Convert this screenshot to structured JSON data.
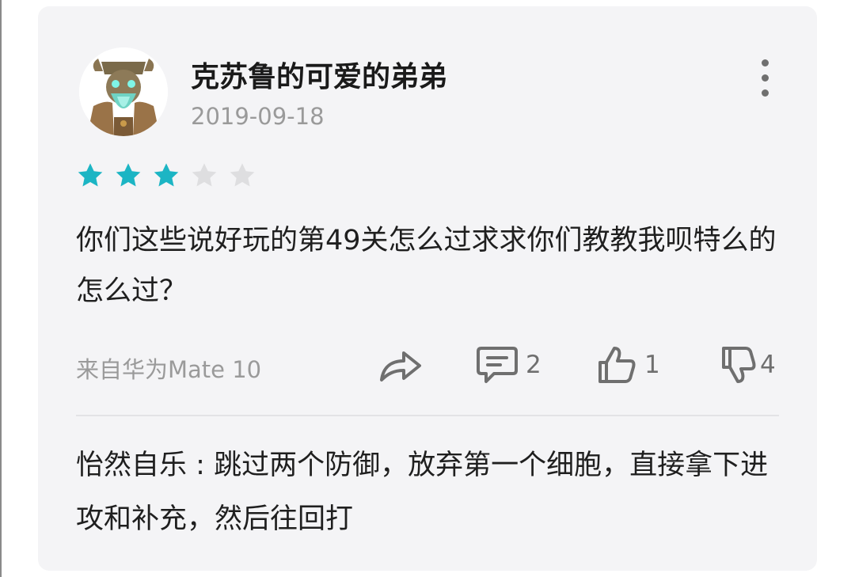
{
  "review": {
    "username": "克苏鲁的可爱的弟弟",
    "date": "2019-09-18",
    "rating": 3,
    "rating_max": 5,
    "star_color": "#1cb5c4",
    "star_empty_color": "#dedee0",
    "content": "你们这些说好玩的第49关怎么过求求你们教教我呗特么的怎么过？",
    "device": "来自华为Mate 10"
  },
  "actions": {
    "share_icon": "share-icon",
    "comment_icon": "comment-icon",
    "comment_count": "2",
    "like_icon": "thumbs-up-icon",
    "like_count": "1",
    "dislike_icon": "thumbs-down-icon",
    "dislike_count": "4"
  },
  "reply": {
    "author": "怡然自乐",
    "text": "跳过两个防御，放弃第一个细胞，直接拿下进攻和补充，然后往回打"
  }
}
